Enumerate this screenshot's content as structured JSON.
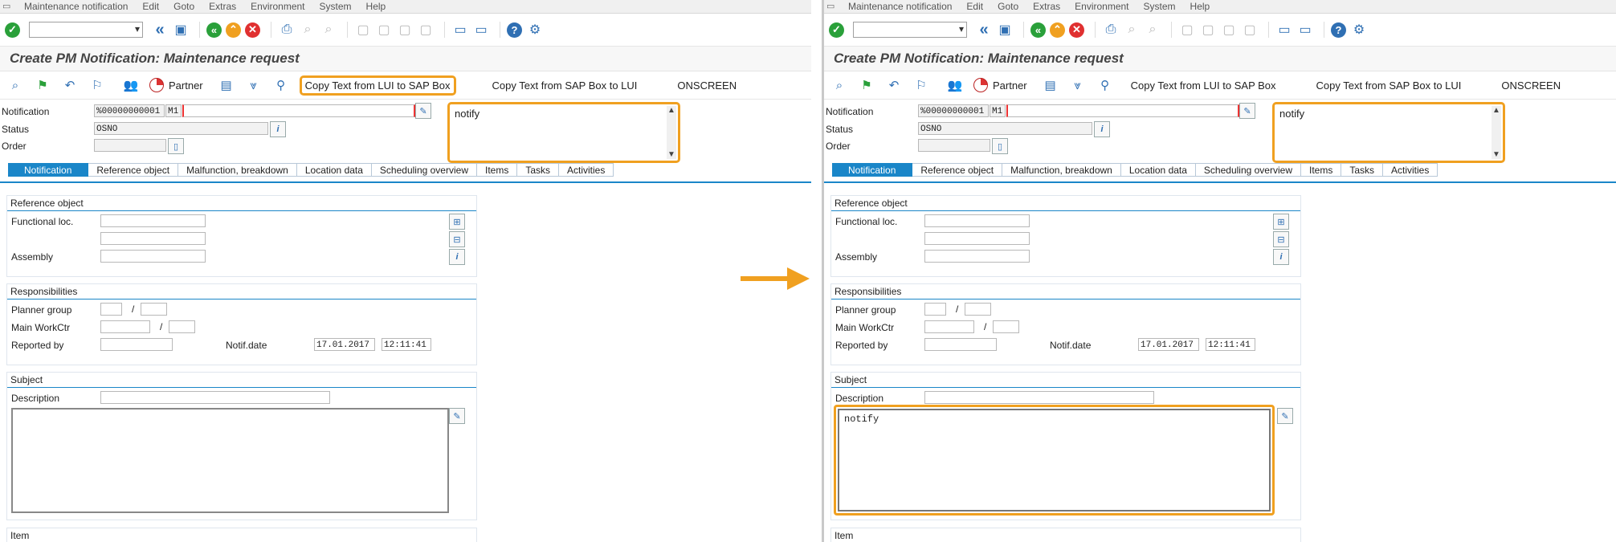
{
  "menu": [
    "Maintenance notification",
    "Edit",
    "Goto",
    "Extras",
    "Environment",
    "System",
    "Help"
  ],
  "title": "Create PM Notification: Maintenance request",
  "app_toolbar": {
    "partner_label": "Partner",
    "copy_lui_to_sap": "Copy Text from LUI to SAP Box",
    "copy_sap_to_lui": "Copy Text from SAP Box to LUI",
    "onscreen": "ONSCREEN"
  },
  "header": {
    "notification_label": "Notification",
    "notification_value": "%00000000001",
    "notification_type": "M1",
    "status_label": "Status",
    "status_value": "OSNO",
    "order_label": "Order",
    "lui_text": "notify"
  },
  "tabs": [
    "Notification",
    "Reference object",
    "Malfunction, breakdown",
    "Location data",
    "Scheduling overview",
    "Items",
    "Tasks",
    "Activities"
  ],
  "reference_object": {
    "title": "Reference object",
    "functional_loc_label": "Functional loc.",
    "assembly_label": "Assembly"
  },
  "responsibilities": {
    "title": "Responsibilities",
    "planner_group_label": "Planner group",
    "main_workctr_label": "Main WorkCtr",
    "reported_by_label": "Reported by",
    "notif_date_label": "Notif.date",
    "notif_date": "17.01.2017",
    "notif_time": "12:11:41",
    "slash": "/"
  },
  "subject": {
    "title": "Subject",
    "description_label": "Description",
    "left_text": "",
    "right_text": "notify"
  },
  "item_title": "Item",
  "colors": {
    "highlight": "#f0a020",
    "accent": "#1a86c8"
  }
}
